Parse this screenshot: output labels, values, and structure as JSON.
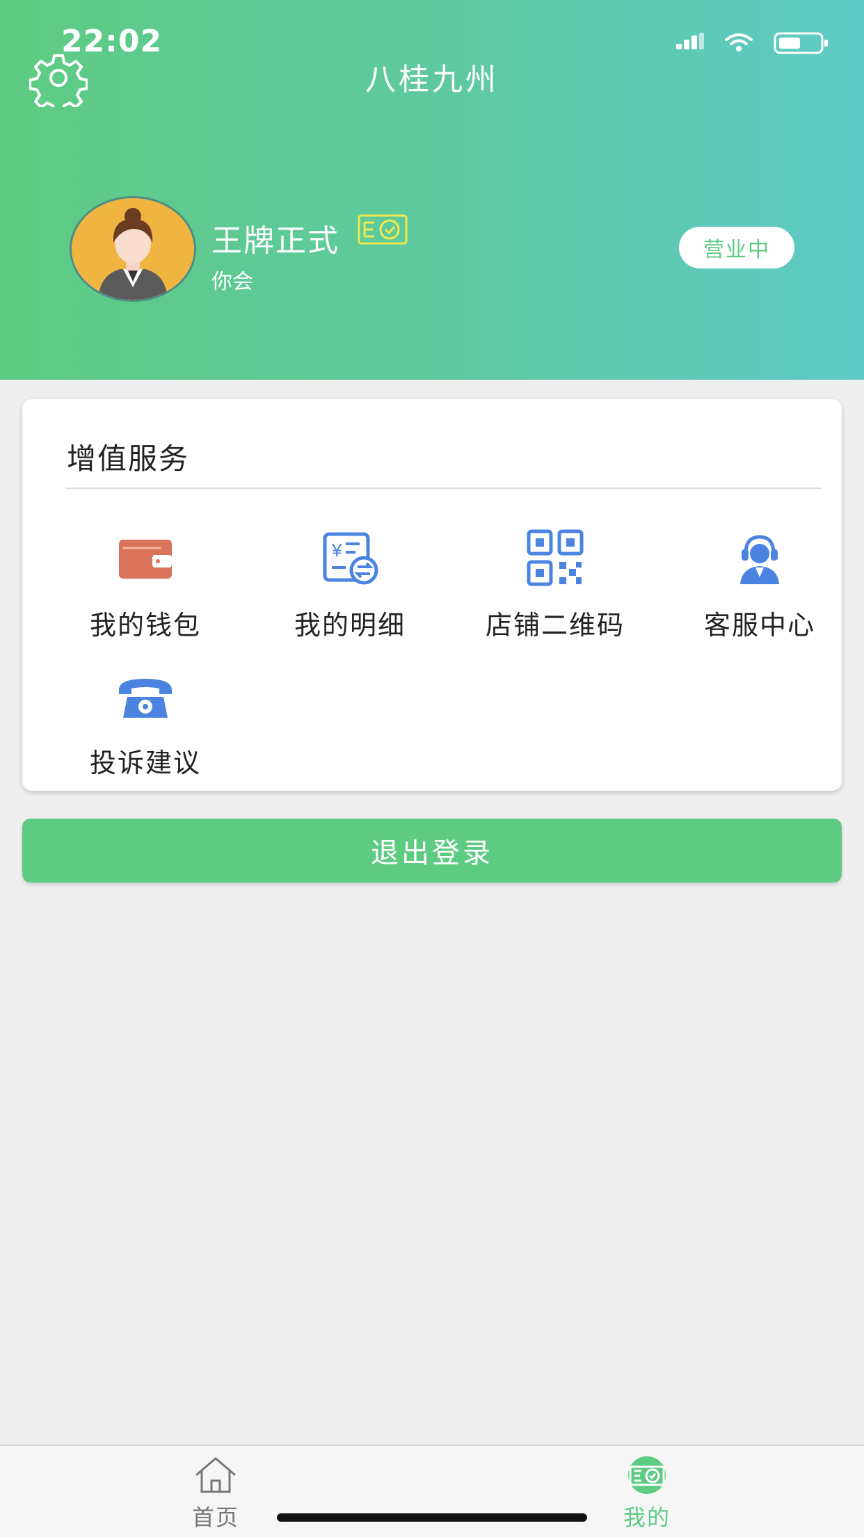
{
  "status_bar": {
    "time": "22:02"
  },
  "header": {
    "title": "八桂九州",
    "user_name": "王牌正式",
    "user_subtitle": "你会",
    "business_status": "营业中",
    "settings_icon": "gear-icon",
    "verified_icon": "certificate-badge-icon"
  },
  "services": {
    "title": "增值服务",
    "items": [
      {
        "label": "我的钱包",
        "icon": "wallet-icon"
      },
      {
        "label": "我的明细",
        "icon": "details-exchange-icon"
      },
      {
        "label": "店铺二维码",
        "icon": "qr-code-icon"
      },
      {
        "label": "客服中心",
        "icon": "customer-service-icon"
      },
      {
        "label": "投诉建议",
        "icon": "telephone-icon"
      }
    ]
  },
  "logout_label": "退出登录",
  "tabbar": {
    "items": [
      {
        "label": "首页",
        "icon": "home-icon",
        "active": false
      },
      {
        "label": "我的",
        "icon": "profile-card-icon",
        "active": true
      }
    ]
  },
  "colors": {
    "primary": "#5ecb83",
    "header_gradient_end": "#5fcbc6",
    "icon_blue": "#4a84e0",
    "wallet_orange": "#d9735a"
  }
}
